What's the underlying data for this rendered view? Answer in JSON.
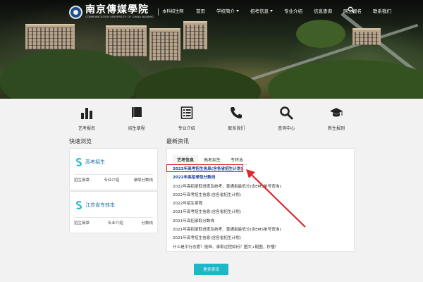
{
  "header": {
    "logo_cn": "南京傳媒學院",
    "logo_en": "COMMUNICATION UNIVERSITY OF CHINA NANJING",
    "logo_sub": "本科招生网",
    "menu": [
      {
        "label": "首页",
        "has_caret": false
      },
      {
        "label": "学校简介",
        "has_caret": true
      },
      {
        "label": "招考信息",
        "has_caret": true
      },
      {
        "label": "专业介绍",
        "has_caret": false
      },
      {
        "label": "信息查询",
        "has_caret": false
      },
      {
        "label": "网上报名",
        "has_caret": false
      },
      {
        "label": "联系我们",
        "has_caret": false
      }
    ],
    "search_icon": "search-icon"
  },
  "quick_links": [
    {
      "label": "艺考报名",
      "icon": "bar-chart-icon"
    },
    {
      "label": "招生章程",
      "icon": "book-icon"
    },
    {
      "label": "专业介绍",
      "icon": "list-icon"
    },
    {
      "label": "联系我们",
      "icon": "phone-icon"
    },
    {
      "label": "查询中心",
      "icon": "search-icon"
    },
    {
      "label": "新生报到",
      "icon": "graduation-cap-icon"
    }
  ],
  "quick_browse": {
    "title": "快速浏览",
    "cards": [
      {
        "title": "高考招生",
        "links": [
          "招生简章",
          "专业介绍",
          "录取分数线"
        ]
      },
      {
        "title": "江苏省专转本",
        "links": [
          "招生简章",
          "专业介绍",
          "分数线"
        ]
      }
    ]
  },
  "news": {
    "title": "最新资讯",
    "tabs": [
      "艺考信息",
      "高考招生",
      "专转本"
    ],
    "active_tab": 0,
    "items": [
      "2023年高考招生信息(含各省招生计划)",
      "2022年高招录取分数线",
      "2022年高招录取进度及统考、普通类最低分(含EMS单号查询)",
      "2022年高考招生信息(含各省招生计划)",
      "2022年招生章程",
      "2021年高考招生信息(含各省招生计划)",
      "2021年高招录取分数线",
      "2021年高招录取进度及统考、普通类最低分(含EMS单号查询)",
      "2021年高考招生信息(含各省招生计划)",
      "什么是平行志愿？投档、录取过程如何？图文+配图，秒懂！"
    ],
    "highlighted_index": 0,
    "highlight_color": "#e0262b"
  },
  "more_button": {
    "label": "更多资讯"
  },
  "colors": {
    "accent": "#1fb7c7",
    "link_blue": "#1d6fa5",
    "highlight_red": "#e0262b"
  }
}
